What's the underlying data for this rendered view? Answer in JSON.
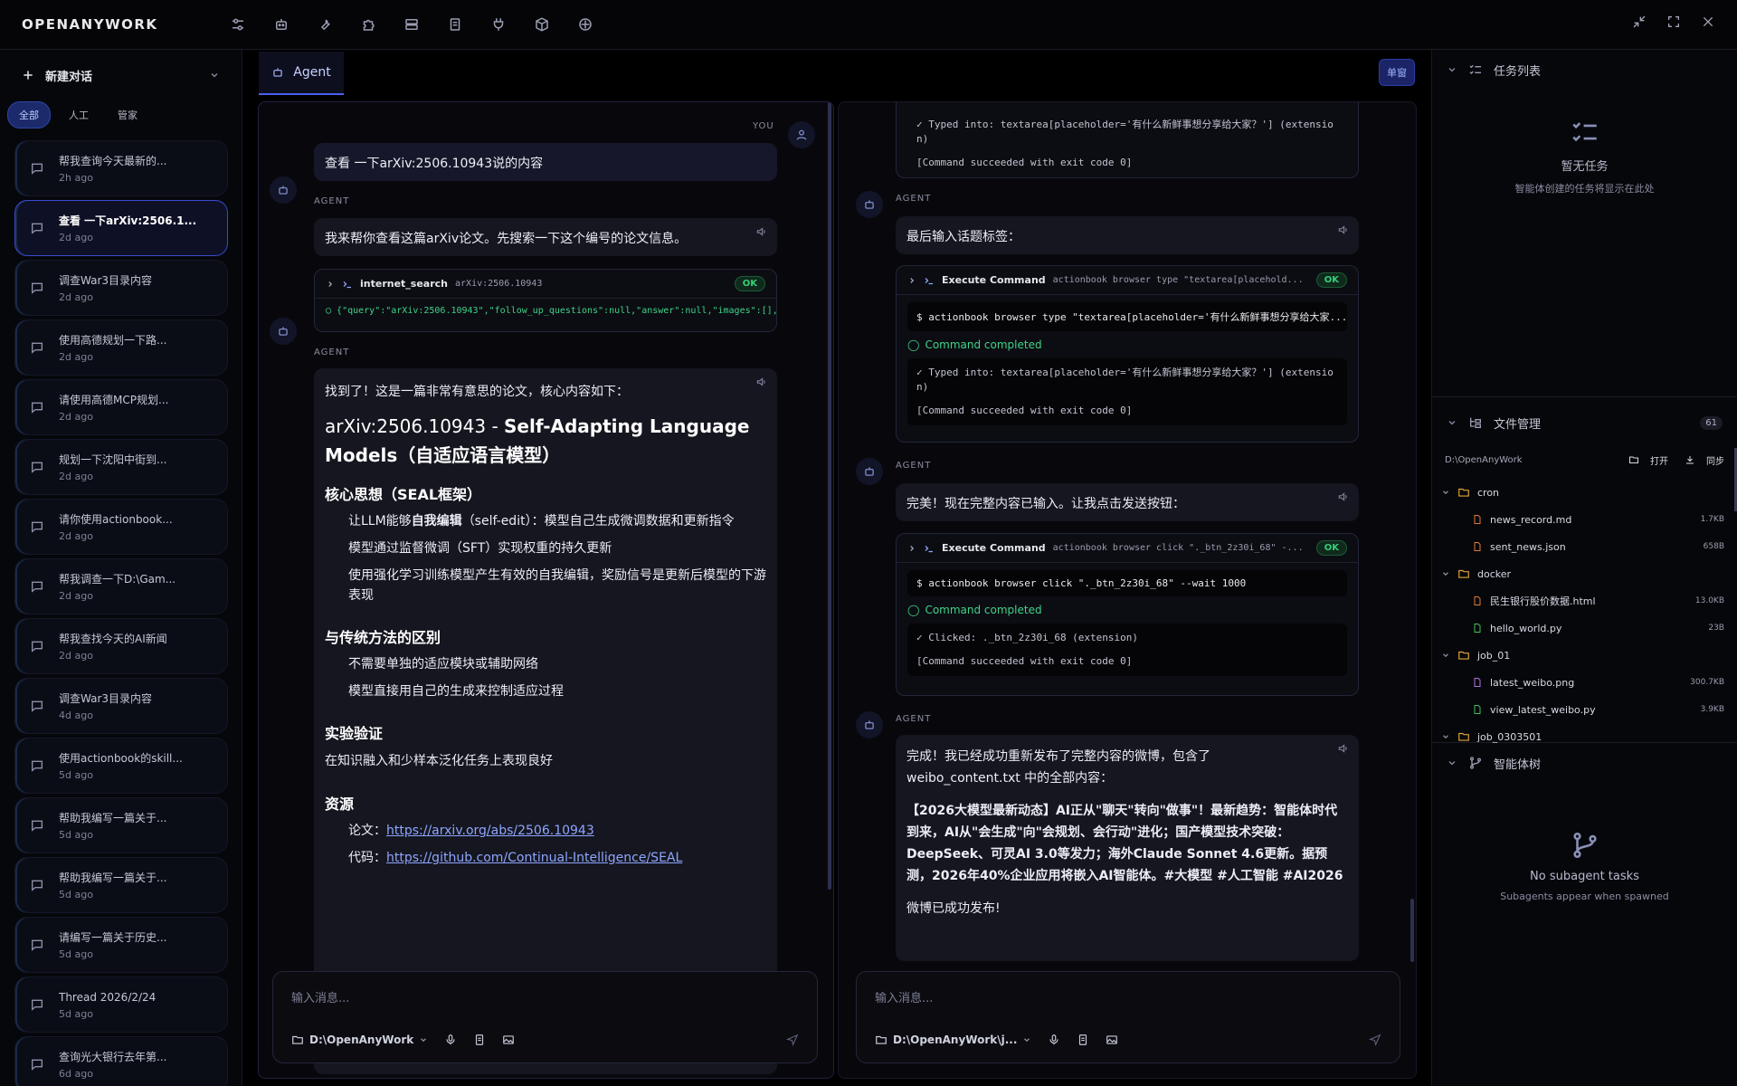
{
  "app": {
    "brand": "OPENANYWORK"
  },
  "sidebar": {
    "new_chat": "新建对话",
    "filters": [
      "全部",
      "人工",
      "管家"
    ],
    "threads": [
      {
        "title": "帮我查询今天最新的...",
        "time": "2h ago"
      },
      {
        "title": "查看 一下arXiv:2506.1...",
        "time": "2d ago"
      },
      {
        "title": "调查War3目录内容",
        "time": "2d ago"
      },
      {
        "title": "使用高德规划一下路...",
        "time": "2d ago"
      },
      {
        "title": "请使用高德MCP规划...",
        "time": "2d ago"
      },
      {
        "title": "规划一下沈阳中街到...",
        "time": "2d ago"
      },
      {
        "title": "请你使用actionbook...",
        "time": "2d ago"
      },
      {
        "title": "帮我调查一下D:\\Gam...",
        "time": "2d ago"
      },
      {
        "title": "帮我查找今天的AI新闻",
        "time": "2d ago"
      },
      {
        "title": "调查War3目录内容",
        "time": "4d ago"
      },
      {
        "title": "使用actionbook的skill...",
        "time": "5d ago"
      },
      {
        "title": "帮助我编写一篇关于...",
        "time": "5d ago"
      },
      {
        "title": "帮助我编写一篇关于...",
        "time": "5d ago"
      },
      {
        "title": "请编写一篇关于历史...",
        "time": "5d ago"
      },
      {
        "title": "Thread 2026/2/24",
        "time": "5d ago"
      },
      {
        "title": "查询光大银行去年第...",
        "time": "6d ago"
      }
    ]
  },
  "tabs": {
    "agent": "Agent",
    "single_window": "单窗"
  },
  "left_chat": {
    "you_label": "YOU",
    "agent_label": "AGENT",
    "user_msg": "查看 一下arXiv:2506.10943说的内容",
    "agent_msg1": "我来帮你查看这篇arXiv论文。先搜索一下这个编号的论文信息。",
    "tool": {
      "name": "internet_search",
      "arg": "arXiv:2506.10943",
      "status": "OK",
      "result": "{\"query\":\"arXiv:2506.10943\",\"follow_up_questions\":null,\"answer\":null,\"images\":[],\"results\":[{\"..."
    },
    "answer": {
      "intro": "找到了！这是一篇非常有意思的论文，核心内容如下：",
      "title_prefix": "arXiv:2506.10943 - ",
      "title_bold": "Self-Adapting Language Models（自适应语言模型）",
      "h_core": "核心思想（SEAL框架）",
      "core_1a": "让LLM能够",
      "core_1b": "自我编辑",
      "core_1c": "（self-edit）：模型自己生成微调数据和更新指令",
      "core_2": "模型通过监督微调（SFT）实现权重的持久更新",
      "core_3": "使用强化学习训练模型产生有效的自我编辑，奖励信号是更新后模型的下游表现",
      "h_diff": "与传统方法的区别",
      "diff_1": "不需要单独的适应模块或辅助网络",
      "diff_2": "模型直接用自己的生成来控制适应过程",
      "h_exp": "实验验证",
      "exp_1": "在知识融入和少样本泛化任务上表现良好",
      "h_res": "资源",
      "res_paper_label": "论文：",
      "res_paper": "https://arxiv.org/abs/2506.10943",
      "res_code_label": "代码：",
      "res_code": "https://github.com/Continual-Intelligence/SEAL"
    },
    "input_placeholder": "输入消息...",
    "workdir": "D:\\OpenAnyWork"
  },
  "right_chat": {
    "agent_label": "AGENT",
    "top_out_1": "✓ Typed into: textarea[placeholder='有什么新鲜事想分享给大家？'] (extensio",
    "top_out_2": "n)",
    "top_out_3": "[Command succeeded with exit code 0]",
    "msg1": "最后输入话题标签：",
    "cmd1": {
      "name": "Execute Command",
      "arg": "actionbook browser type \"textarea[placehold...",
      "status": "OK",
      "line": "$ actionbook browser type \"textarea[placeholder='有什么新鲜事想分享给大家...",
      "done": "Command completed",
      "out_1": "✓ Typed into: textarea[placeholder='有什么新鲜事想分享给大家？'] (extensio",
      "out_2": "n)",
      "out_3": "[Command succeeded with exit code 0]"
    },
    "msg2": "完美！现在完整内容已输入。让我点击发送按钮：",
    "cmd2": {
      "name": "Execute Command",
      "arg": "actionbook browser click \"._btn_2z30i_68\" -...",
      "status": "OK",
      "line": "$ actionbook browser click \"._btn_2z30i_68\" --wait 1000",
      "done": "Command completed",
      "out_1": "✓ Clicked: ._btn_2z30i_68 (extension)",
      "out_2": "[Command succeeded with exit code 0]"
    },
    "msg3_a": "完成！我已经成功重新发布了完整内容的微博，包含了",
    "msg3_b": "weibo_content.txt 中的全部内容：",
    "msg3_bold": "【2026大模型最新动态】AI正从\"聊天\"转向\"做事\"！最新趋势：智能体时代到来，AI从\"会生成\"向\"会规划、会行动\"进化；国产模型技术突破：DeepSeek、可灵AI 3.0等发力；海外Claude Sonnet 4.6更新。据预测，2026年40%企业应用将嵌入AI智能体。#大模型 #人工智能 #AI2026",
    "msg3_end": "微博已成功发布!",
    "input_placeholder": "输入消息...",
    "workdir": "D:\\OpenAnyWork\\j..."
  },
  "tasks": {
    "title": "任务列表",
    "empty_title": "暂无任务",
    "empty_sub": "智能体创建的任务将显示在此处"
  },
  "files": {
    "title": "文件管理",
    "count": "61",
    "root": "D:\\OpenAnyWork",
    "open": "打开",
    "sync": "同步",
    "tree": [
      {
        "type": "folder",
        "name": "cron",
        "size": ""
      },
      {
        "type": "file",
        "name": "news_record.md",
        "size": "1.7KB",
        "color": "#e07a3a"
      },
      {
        "type": "file",
        "name": "sent_news.json",
        "size": "658B",
        "color": "#e07a3a"
      },
      {
        "type": "folder",
        "name": "docker",
        "size": ""
      },
      {
        "type": "file",
        "name": "民生银行股价数据.html",
        "size": "13.0KB",
        "color": "#e07a3a"
      },
      {
        "type": "file",
        "name": "hello_world.py",
        "size": "23B",
        "color": "#3fbf5a"
      },
      {
        "type": "folder",
        "name": "job_01",
        "size": ""
      },
      {
        "type": "file",
        "name": "latest_weibo.png",
        "size": "300.7KB",
        "color": "#b070e0"
      },
      {
        "type": "file",
        "name": "view_latest_weibo.py",
        "size": "3.9KB",
        "color": "#3fbf5a"
      },
      {
        "type": "folder",
        "name": "job_0303501",
        "size": ""
      }
    ]
  },
  "agents": {
    "title": "智能体树",
    "empty_title": "No subagent tasks",
    "empty_sub": "Subagents appear when spawned"
  }
}
